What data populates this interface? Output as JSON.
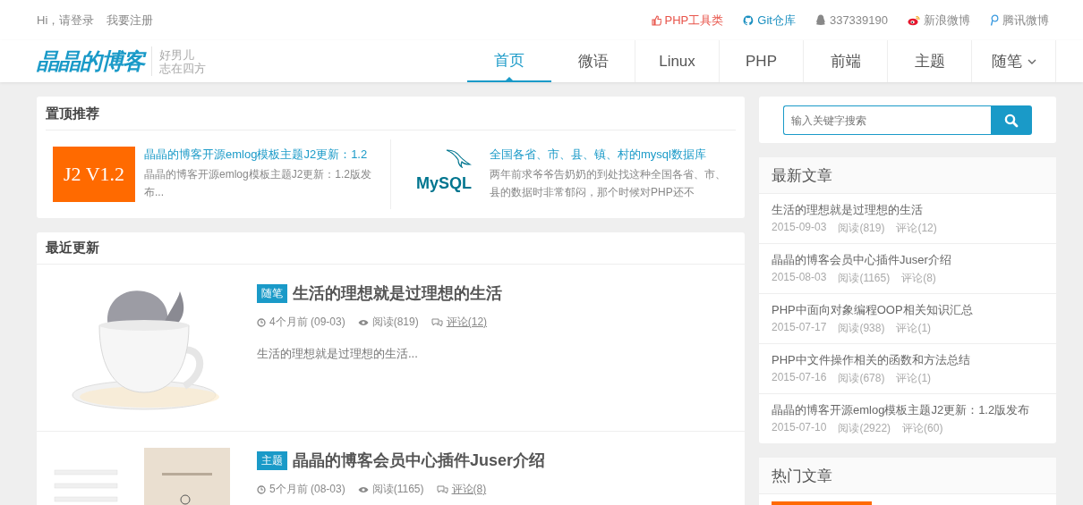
{
  "top_bar": {
    "account_links": [
      "Hi，请登录",
      "我要注册"
    ],
    "links": [
      {
        "kind": "thumb",
        "label": "PHP工具类",
        "color": "#e8544a"
      },
      {
        "kind": "github",
        "label": "Git仓库",
        "color": "#1a8fc0"
      },
      {
        "kind": "qq",
        "label": "337339190",
        "color": "#888888"
      },
      {
        "kind": "weibo",
        "label": "新浪微博",
        "color": "#888888"
      },
      {
        "kind": "tweibo",
        "label": "腾讯微博",
        "color": "#888888"
      }
    ]
  },
  "logo": {
    "text": "晶晶的博客",
    "slogan": [
      "好男儿",
      "志在四方"
    ]
  },
  "nav": [
    {
      "label": "首页",
      "selected": true,
      "dropdown": false
    },
    {
      "label": "微语",
      "selected": false,
      "dropdown": false
    },
    {
      "label": "Linux",
      "selected": false,
      "dropdown": false
    },
    {
      "label": "PHP",
      "selected": false,
      "dropdown": false
    },
    {
      "label": "前端",
      "selected": false,
      "dropdown": false
    },
    {
      "label": "主题",
      "selected": false,
      "dropdown": false
    },
    {
      "label": "随笔",
      "selected": false,
      "dropdown": true
    }
  ],
  "pinned": {
    "title": "置顶推荐",
    "items": [
      {
        "thumb": {
          "kind": "banner",
          "text": "J2 V1.2"
        },
        "title": "晶晶的博客开源emlog模板主题J2更新：1.2",
        "excerpt": "晶晶的博客开源emlog模板主题J2更新：1.2版发布..."
      },
      {
        "thumb": {
          "kind": "mysql",
          "text": "MySQL"
        },
        "title": "全国各省、市、县、镇、村的mysql数据库",
        "excerpt": "两年前求爷爷告奶奶的到处找这种全国各省、市、县的数据时非常郁闷，那个时候对PHP还不"
      }
    ]
  },
  "recent": {
    "title": "最近更新",
    "posts": [
      {
        "thumb": {
          "kind": "cup"
        },
        "tag": "随笔",
        "title": "生活的理想就是过理想的生活",
        "time": "4个月前 (09-03)",
        "views": "阅读(819)",
        "comments": "评论(12)",
        "excerpt": "生活的理想就是过理想的生活..."
      },
      {
        "thumb": {
          "kind": "screens"
        },
        "tag": "主题",
        "title": "晶晶的博客会员中心插件Juser介绍",
        "time": "5个月前 (08-03)",
        "views": "阅读(1165)",
        "comments": "评论(8)"
      }
    ]
  },
  "search": {
    "placeholder": "输入关键字搜索"
  },
  "latest": {
    "title": "最新文章",
    "items": [
      {
        "title": "生活的理想就是过理想的生活",
        "date": "2015-09-03",
        "views": "阅读(819)",
        "comments": "评论(12)"
      },
      {
        "title": "晶晶的博客会员中心插件Juser介绍",
        "date": "2015-08-03",
        "views": "阅读(1165)",
        "comments": "评论(8)"
      },
      {
        "title": "PHP中面向对象编程OOP相关知识汇总",
        "date": "2015-07-17",
        "views": "阅读(938)",
        "comments": "评论(1)"
      },
      {
        "title": "PHP中文件操作相关的函数和方法总结",
        "date": "2015-07-16",
        "views": "阅读(678)",
        "comments": "评论(1)"
      },
      {
        "title": "晶晶的博客开源emlog模板主题J2更新：1.2版发布",
        "date": "2015-07-10",
        "views": "阅读(2922)",
        "comments": "评论(60)"
      }
    ]
  },
  "hot": {
    "title": "热门文章",
    "items": [
      {
        "thumb": {
          "kind": "banner"
        }
      }
    ]
  }
}
